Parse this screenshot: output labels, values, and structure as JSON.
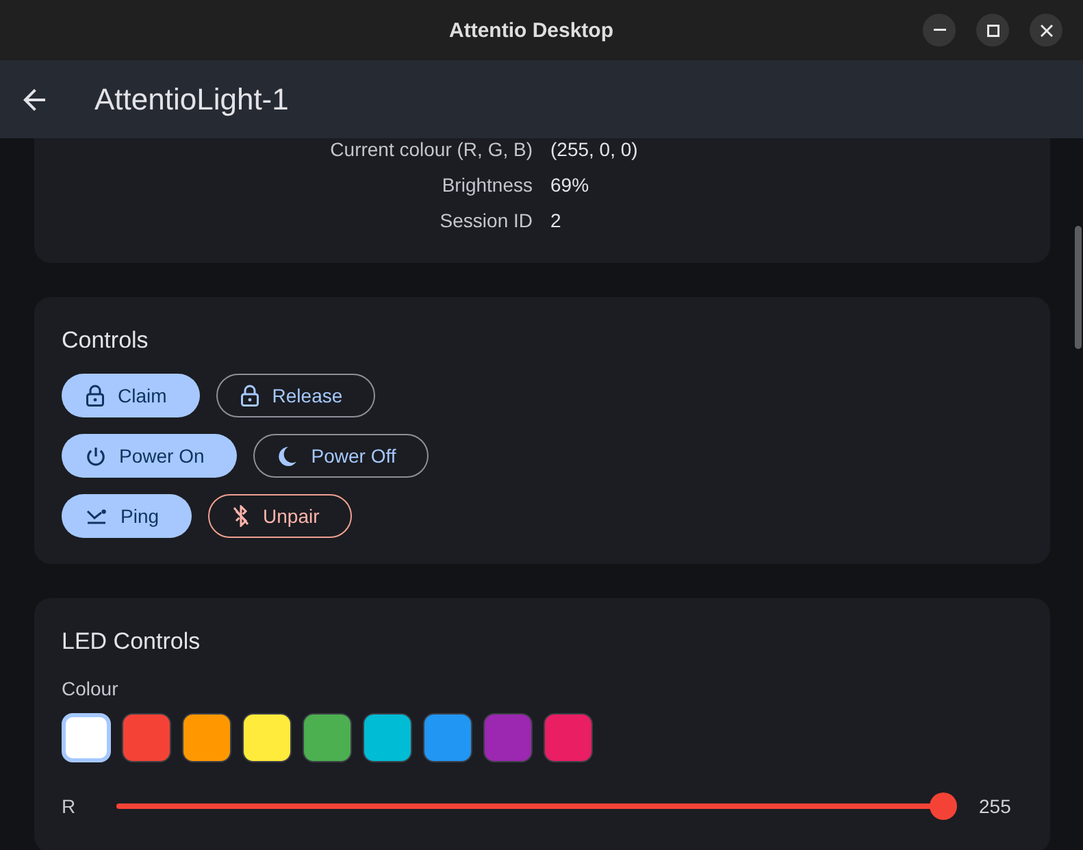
{
  "window": {
    "title": "Attentio Desktop"
  },
  "app_bar": {
    "title": "AttentioLight-1"
  },
  "device_info": {
    "rows": [
      {
        "label": "Current colour (R, G, B)",
        "value": "(255, 0, 0)"
      },
      {
        "label": "Brightness",
        "value": "69%"
      },
      {
        "label": "Session ID",
        "value": "2"
      }
    ]
  },
  "controls": {
    "title": "Controls",
    "button_rows": [
      [
        {
          "label": "Claim",
          "kind": "filled"
        },
        {
          "label": "Release",
          "kind": "outlined"
        }
      ],
      [
        {
          "label": "Power On",
          "kind": "filled"
        },
        {
          "label": "Power Off",
          "kind": "outlined"
        }
      ],
      [
        {
          "label": "Ping",
          "kind": "filled"
        },
        {
          "label": "Unpair",
          "kind": "danger"
        }
      ]
    ]
  },
  "led_controls": {
    "title": "LED Controls",
    "colour_label": "Colour",
    "swatches": [
      {
        "color": "#ffffff",
        "selected": true
      },
      {
        "color": "#f44336",
        "selected": false
      },
      {
        "color": "#ff9800",
        "selected": false
      },
      {
        "color": "#ffeb3b",
        "selected": false
      },
      {
        "color": "#4caf50",
        "selected": false
      },
      {
        "color": "#00bcd4",
        "selected": false
      },
      {
        "color": "#2196f3",
        "selected": false
      },
      {
        "color": "#9c27b0",
        "selected": false
      },
      {
        "color": "#e91e63",
        "selected": false
      }
    ],
    "sliders": [
      {
        "label": "R",
        "level": 1,
        "reading": "255",
        "color": "#f44336"
      }
    ]
  }
}
